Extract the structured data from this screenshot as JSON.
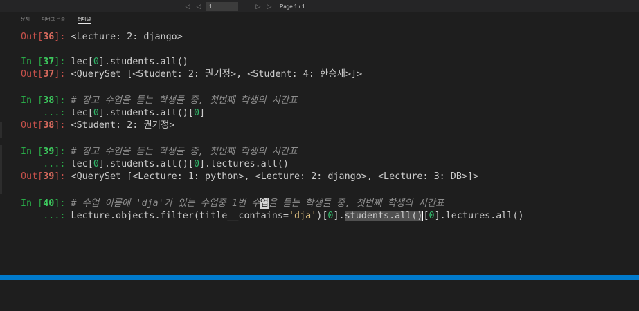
{
  "pager": {
    "first_icon": "◁",
    "prev_icon": "◁",
    "page_input": "1",
    "next_icon": "▷",
    "last_icon": "▷",
    "page_label": "Page 1 / 1"
  },
  "tabs": [
    {
      "label": "문제"
    },
    {
      "label": "디버그 콘솔"
    },
    {
      "label": "터미널"
    }
  ],
  "console": {
    "l1_prompt": "Out[",
    "l1_num": "36",
    "l1_close": "]:",
    "l1_text": " <Lecture: 2: django>",
    "l2_prompt": "In [",
    "l2_num": "37",
    "l2_close": "]:",
    "l2_pre": " lec[",
    "l2_idx": "0",
    "l2_post": "].students.all()",
    "l3_prompt": "Out[",
    "l3_num": "37",
    "l3_close": "]:",
    "l3_text": " <QuerySet [<Student: 2: 권기정>, <Student: 4: 한승재>]>",
    "l4_prompt": "In [",
    "l4_num": "38",
    "l4_close": "]:",
    "l4_comment": " # 장고 수업을 듣는 학생들 중, 첫번째 학생의 시간표",
    "l5_cont": "    ...:",
    "l5_pre": " lec[",
    "l5_idx": "0",
    "l5_mid": "].students.all()[",
    "l5_idx2": "0",
    "l5_post": "]",
    "l6_prompt": "Out[",
    "l6_num": "38",
    "l6_close": "]:",
    "l6_text": " <Student: 2: 권기정>",
    "l7_prompt": "In [",
    "l7_num": "39",
    "l7_close": "]:",
    "l7_comment": " # 장고 수업을 듣는 학생들 중, 첫번째 학생의 시간표",
    "l8_cont": "    ...:",
    "l8_pre": " lec[",
    "l8_idx": "0",
    "l8_mid": "].students.all()[",
    "l8_idx2": "0",
    "l8_post": "].lectures.all()",
    "l9_prompt": "Out[",
    "l9_num": "39",
    "l9_close": "]:",
    "l9_text": " <QuerySet [<Lecture: 1: python>, <Lecture: 2: django>, <Lecture: 3: DB>]>",
    "l10_prompt": "In [",
    "l10_num": "40",
    "l10_close": "]:",
    "l10_c1": " # 수업 이름에 'dja'가 있는 수업중 1번 수",
    "l10_cursor": "업",
    "l10_c2": "을 듣는 학생들 중, 첫번째 학생의 시간표",
    "l11_cont": "    ...:",
    "l11_pre": " Lecture.objects.filter(title__contains=",
    "l11_str": "'dja'",
    "l11_mid": ")[",
    "l11_idx": "0",
    "l11_dot": "].",
    "l11_sel": "students.all()",
    "l11_open": "[",
    "l11_idx2": "0",
    "l11_post": "].lectures.all()"
  },
  "colors": {
    "background": "#1e1e1e",
    "out_prompt": "#c5504a",
    "in_prompt": "#29a847",
    "string": "#d7ba7d",
    "statusbar": "#007acc"
  }
}
